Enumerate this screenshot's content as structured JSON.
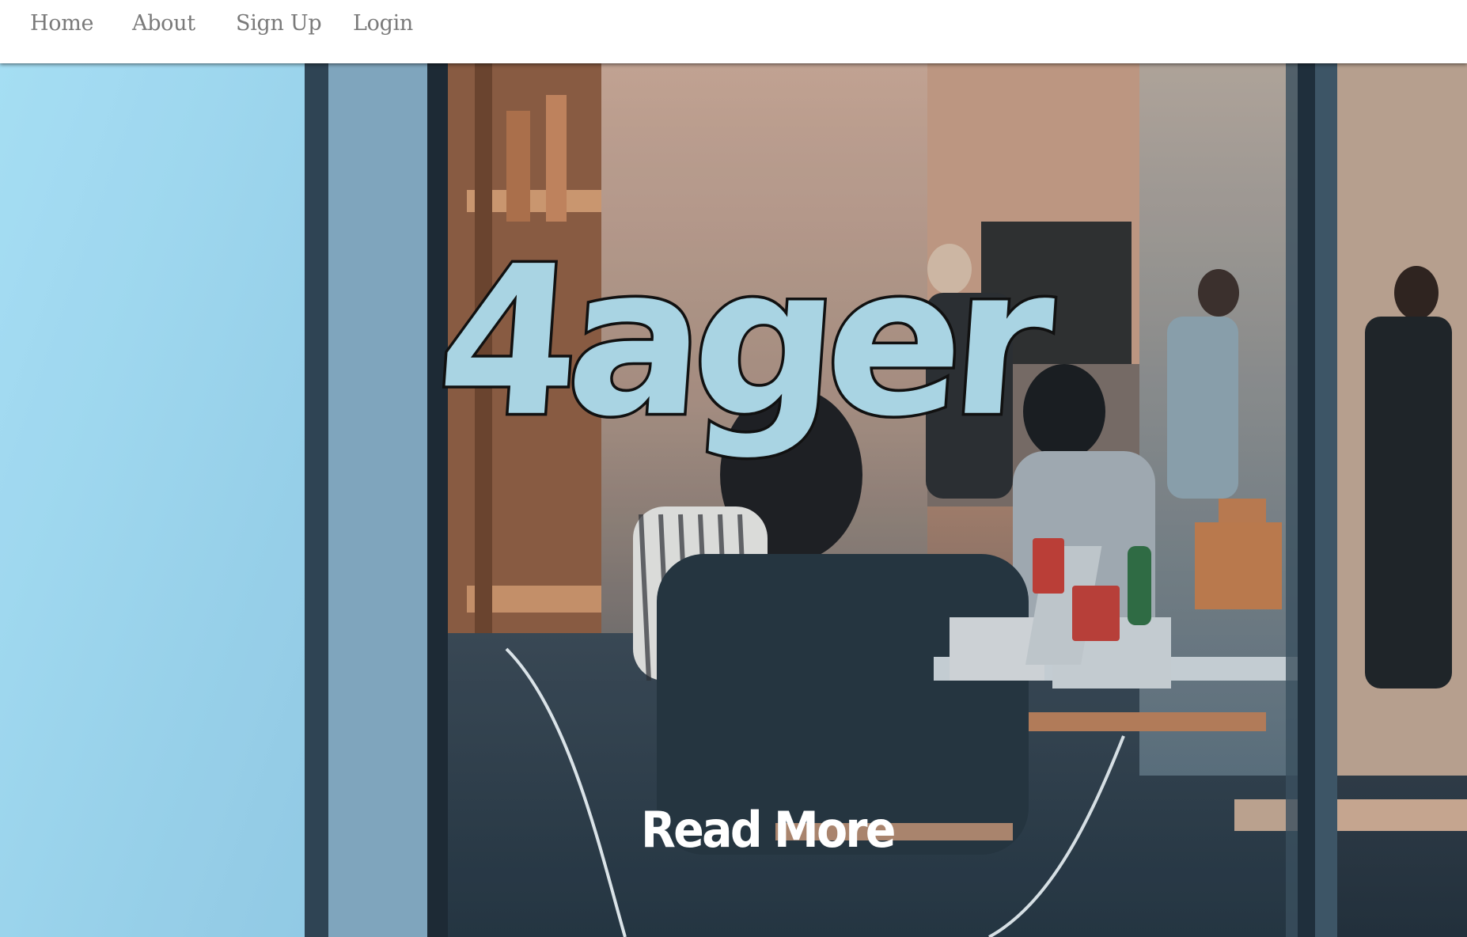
{
  "nav": {
    "items": [
      {
        "label": "Home"
      },
      {
        "label": "About"
      },
      {
        "label": "Sign Up"
      },
      {
        "label": "Login"
      }
    ]
  },
  "hero": {
    "title": "4ager",
    "cta_label": "Read More",
    "title_color": "#a9d4e3",
    "cta_color": "#ffffff"
  }
}
